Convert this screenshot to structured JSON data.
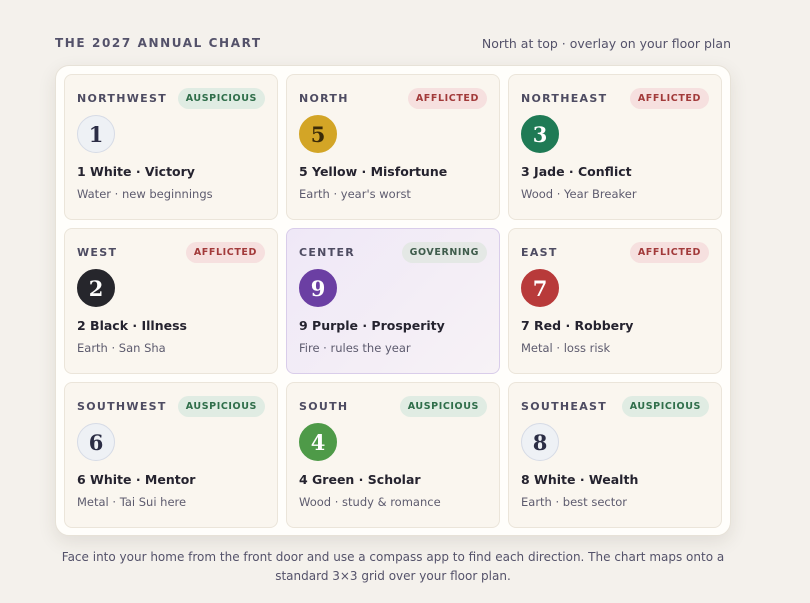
{
  "header": {
    "title": "THE 2027 ANNUAL CHART",
    "subtitle": "North at top · overlay on your floor plan"
  },
  "cells": [
    {
      "direction": "NORTHWEST",
      "badge": "AUSPICIOUS",
      "badge_kind": "good",
      "star": "1",
      "star_bg": "#eef1f5",
      "star_fg": "#2b2d45",
      "star_border": "#d6dbe6",
      "name": "1 White · Victory",
      "desc": "Water · new beginnings"
    },
    {
      "direction": "NORTH",
      "badge": "AFFLICTED",
      "badge_kind": "bad",
      "star": "5",
      "star_bg": "#d3a526",
      "star_fg": "#3a2a08",
      "star_border": "#d3a526",
      "name": "5 Yellow · Misfortune",
      "desc": "Earth · year's worst"
    },
    {
      "direction": "NORTHEAST",
      "badge": "AFFLICTED",
      "badge_kind": "bad",
      "star": "3",
      "star_bg": "#1f7a55",
      "star_fg": "#ffffff",
      "star_border": "#1f7a55",
      "name": "3 Jade · Conflict",
      "desc": "Wood · Year Breaker"
    },
    {
      "direction": "WEST",
      "badge": "AFFLICTED",
      "badge_kind": "bad",
      "star": "2",
      "star_bg": "#26262c",
      "star_fg": "#ffffff",
      "star_border": "#26262c",
      "name": "2 Black · Illness",
      "desc": "Earth · San Sha"
    },
    {
      "direction": "CENTER",
      "badge": "GOVERNING",
      "badge_kind": "gov",
      "star": "9",
      "star_bg": "#6b3fa3",
      "star_fg": "#ffffff",
      "star_border": "#6b3fa3",
      "name": "9 Purple · Prosperity",
      "desc": "Fire · rules the year",
      "center": true
    },
    {
      "direction": "EAST",
      "badge": "AFFLICTED",
      "badge_kind": "bad",
      "star": "7",
      "star_bg": "#b83a3a",
      "star_fg": "#ffffff",
      "star_border": "#b83a3a",
      "name": "7 Red · Robbery",
      "desc": "Metal · loss risk"
    },
    {
      "direction": "SOUTHWEST",
      "badge": "AUSPICIOUS",
      "badge_kind": "good",
      "star": "6",
      "star_bg": "#eef1f5",
      "star_fg": "#2b2d45",
      "star_border": "#d6dbe6",
      "name": "6 White · Mentor",
      "desc": "Metal · Tai Sui here"
    },
    {
      "direction": "SOUTH",
      "badge": "AUSPICIOUS",
      "badge_kind": "good",
      "star": "4",
      "star_bg": "#4e9a48",
      "star_fg": "#ffffff",
      "star_border": "#4e9a48",
      "name": "4 Green · Scholar",
      "desc": "Wood · study & romance"
    },
    {
      "direction": "SOUTHEAST",
      "badge": "AUSPICIOUS",
      "badge_kind": "good",
      "star": "8",
      "star_bg": "#eef1f5",
      "star_fg": "#2b2d45",
      "star_border": "#d6dbe6",
      "name": "8 White · Wealth",
      "desc": "Earth · best sector"
    }
  ],
  "footer": {
    "line1": "Face into your home from the front door and use a compass app to find each direction. The chart maps onto a",
    "line2": "standard 3×3 grid over your floor plan."
  }
}
